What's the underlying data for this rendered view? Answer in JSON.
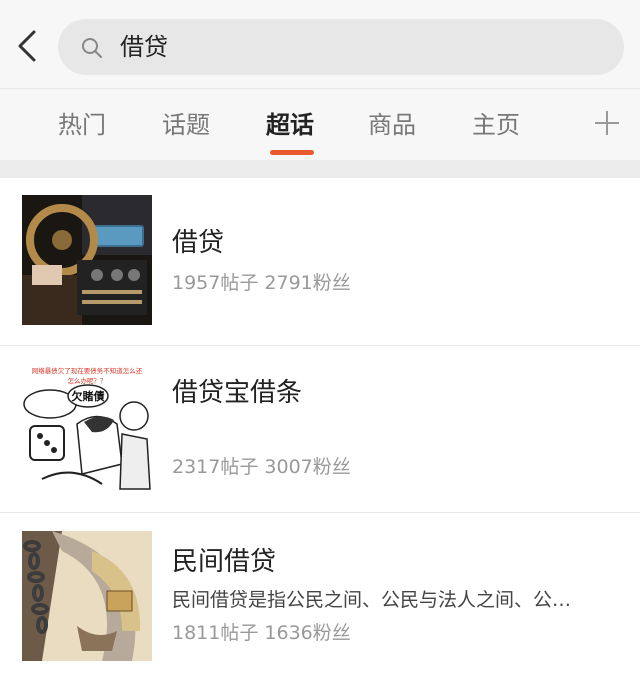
{
  "header": {
    "back_icon": "chevron-left-icon",
    "search_icon": "search-icon",
    "search_query": "借贷"
  },
  "tabs": [
    {
      "label": "热门",
      "active": false
    },
    {
      "label": "话题",
      "active": false
    },
    {
      "label": "超话",
      "active": true
    },
    {
      "label": "商品",
      "active": false
    },
    {
      "label": "主页",
      "active": false
    }
  ],
  "tabs_more_icon": "plus-icon",
  "accent_color": "#e8592d",
  "results": [
    {
      "title": "借贷",
      "description": "",
      "stats": "1957帖子 2791粉丝"
    },
    {
      "title": "借贷宝借条",
      "description": "",
      "stats": "2317帖子 3007粉丝",
      "thumb_text": "网络暴债欠了现在要债务不知道怎么还 怎么办呢？？"
    },
    {
      "title": "民间借贷",
      "description": "民间借贷是指公民之间、公民与法人之间、公…",
      "stats": "1811帖子 1636粉丝"
    }
  ]
}
